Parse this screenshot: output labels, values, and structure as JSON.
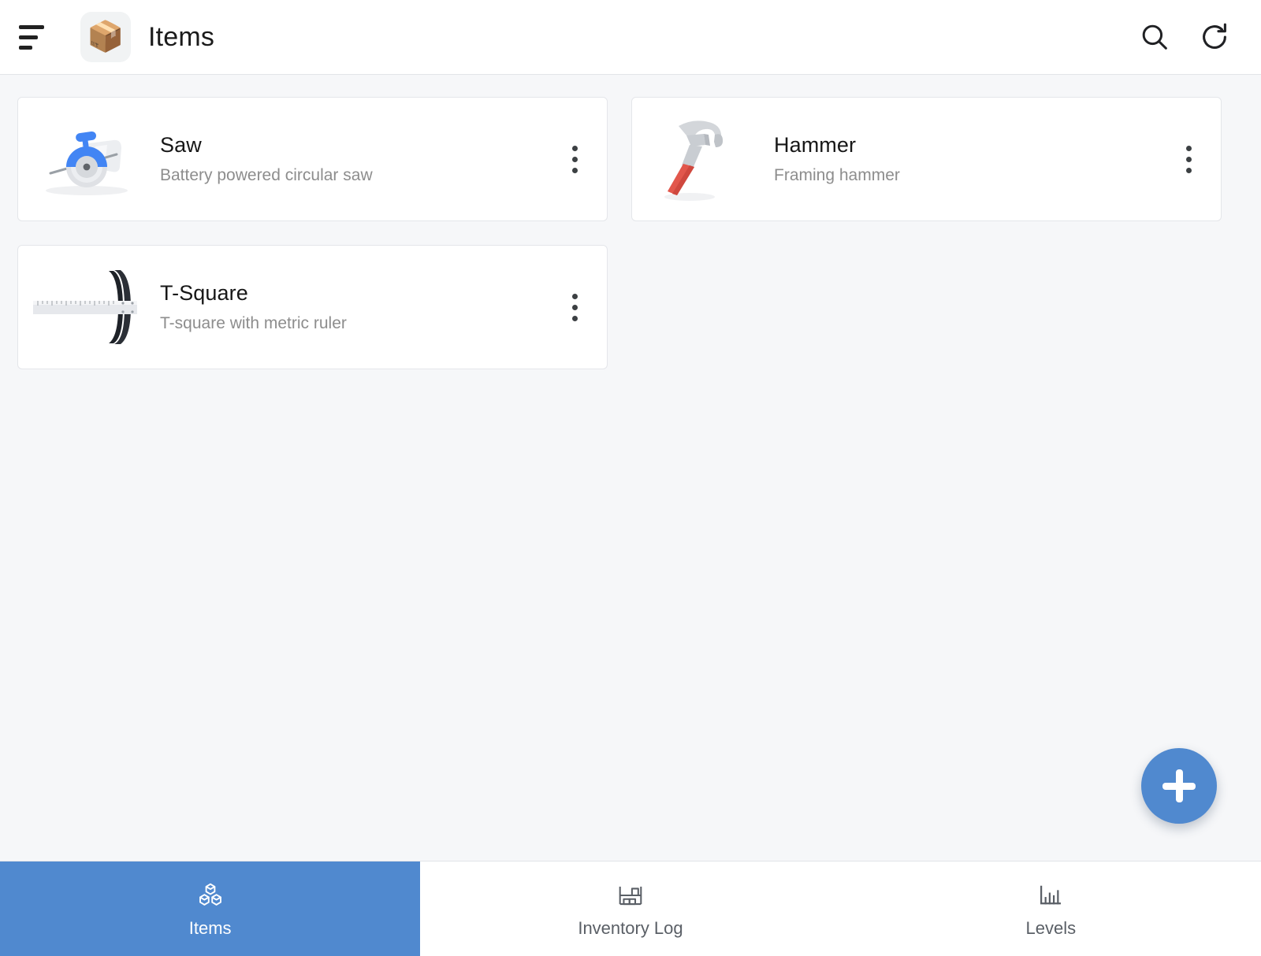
{
  "appbar": {
    "menu_icon": "menu-sort-icon",
    "logo_glyph": "📦",
    "logo_name": "package-icon",
    "title": "Items",
    "actions": [
      {
        "name": "search-icon",
        "label": "Search"
      },
      {
        "name": "refresh-icon",
        "label": "Refresh"
      }
    ]
  },
  "colors": {
    "accent": "#5089cf",
    "page_background": "#f6f7f9",
    "card_background": "#ffffff",
    "card_border": "#e4e6ea",
    "title_text": "#171717",
    "subtitle_text": "#8d8d8d",
    "nav_inactive_text": "#5a5f66",
    "nav_active_text": "#ffffff"
  },
  "items": [
    {
      "name": "Saw",
      "description": "Battery powered circular saw",
      "icon": "circular-saw-icon",
      "overflow_label": "More options"
    },
    {
      "name": "Hammer",
      "description": "Framing hammer",
      "icon": "claw-hammer-icon",
      "overflow_label": "More options"
    },
    {
      "name": "T-Square",
      "description": "T-square with metric ruler",
      "icon": "t-square-icon",
      "overflow_label": "More options"
    }
  ],
  "fab": {
    "name": "add-item-button",
    "icon": "plus-icon",
    "label": "Add"
  },
  "bottom_nav": {
    "tabs": [
      {
        "label": "Items",
        "icon": "cubes-icon",
        "active": true
      },
      {
        "label": "Inventory Log",
        "icon": "shelves-icon",
        "active": false
      },
      {
        "label": "Levels",
        "icon": "bar-chart-icon",
        "active": false
      }
    ]
  }
}
